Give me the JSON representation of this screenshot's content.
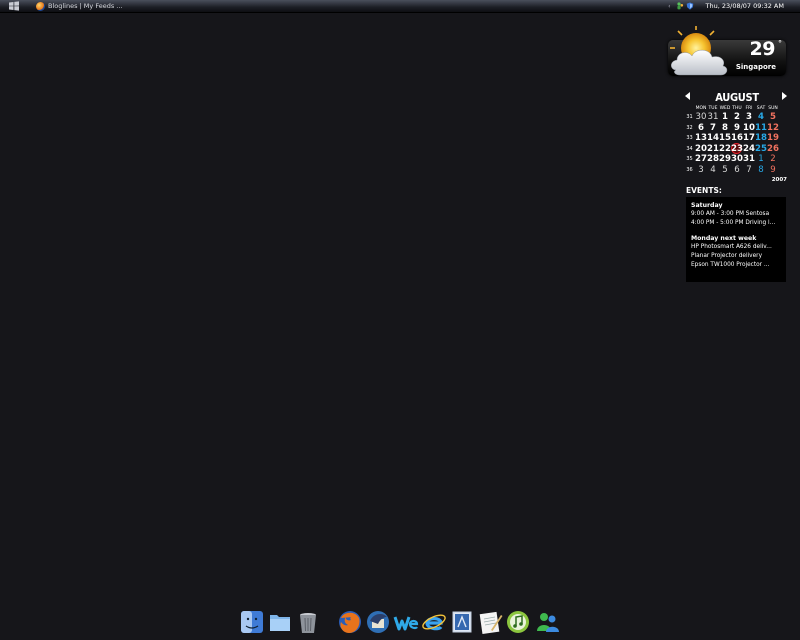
{
  "taskbar": {
    "start_icon": "windows-logo-icon",
    "task_title": "Bloglines | My Feeds ...",
    "task_icon": "firefox-icon",
    "tray_arrow": "‹",
    "clock": "Thu, 23/08/07 09:32 AM"
  },
  "weather": {
    "temperature": "29",
    "unit": "°",
    "city": "Singapore",
    "condition_icon": "sun-cloud-icon"
  },
  "calendar": {
    "month": "AUGUST",
    "year": "2007",
    "weekdays": [
      "MON",
      "TUE",
      "WED",
      "THU",
      "FRI",
      "SAT",
      "SUN"
    ],
    "weeks": [
      {
        "num": "31",
        "days": [
          "30",
          "31",
          "1",
          "2",
          "3",
          "4",
          "5"
        ]
      },
      {
        "num": "32",
        "days": [
          "6",
          "7",
          "8",
          "9",
          "10",
          "11",
          "12"
        ]
      },
      {
        "num": "33",
        "days": [
          "13",
          "14",
          "15",
          "16",
          "17",
          "18",
          "19"
        ]
      },
      {
        "num": "34",
        "days": [
          "20",
          "21",
          "22",
          "23",
          "24",
          "25",
          "26"
        ]
      },
      {
        "num": "35",
        "days": [
          "27",
          "28",
          "29",
          "30",
          "31",
          "1",
          "2"
        ]
      },
      {
        "num": "36",
        "days": [
          "3",
          "4",
          "5",
          "6",
          "7",
          "8",
          "9"
        ]
      }
    ],
    "today": "23",
    "colors": {
      "weekday": "#ffffff",
      "saturday": "#27a8e6",
      "sunday": "#f1725f",
      "today_ring": "#e8202a"
    }
  },
  "events": {
    "title": "EVENTS:",
    "groups": [
      {
        "heading": "Saturday",
        "items": [
          "9:00 AM - 3:00 PM Sentosa",
          "4:00 PM - 5:00 PM Driving l..."
        ]
      },
      {
        "heading": "Monday next week",
        "items": [
          "HP Photosmart A626 deliv...",
          "Planar Projector delivery",
          "Epson TW1000 Projector ..."
        ]
      }
    ]
  },
  "dock": {
    "items": [
      "finder-icon",
      "folder-icon",
      "trash-icon",
      "firefox-icon",
      "thunderbird-icon",
      "windows-live-writer-icon",
      "internet-explorer-icon",
      "mail-stamp-icon",
      "textedit-icon",
      "itunes-icon",
      "messenger-icon"
    ]
  }
}
